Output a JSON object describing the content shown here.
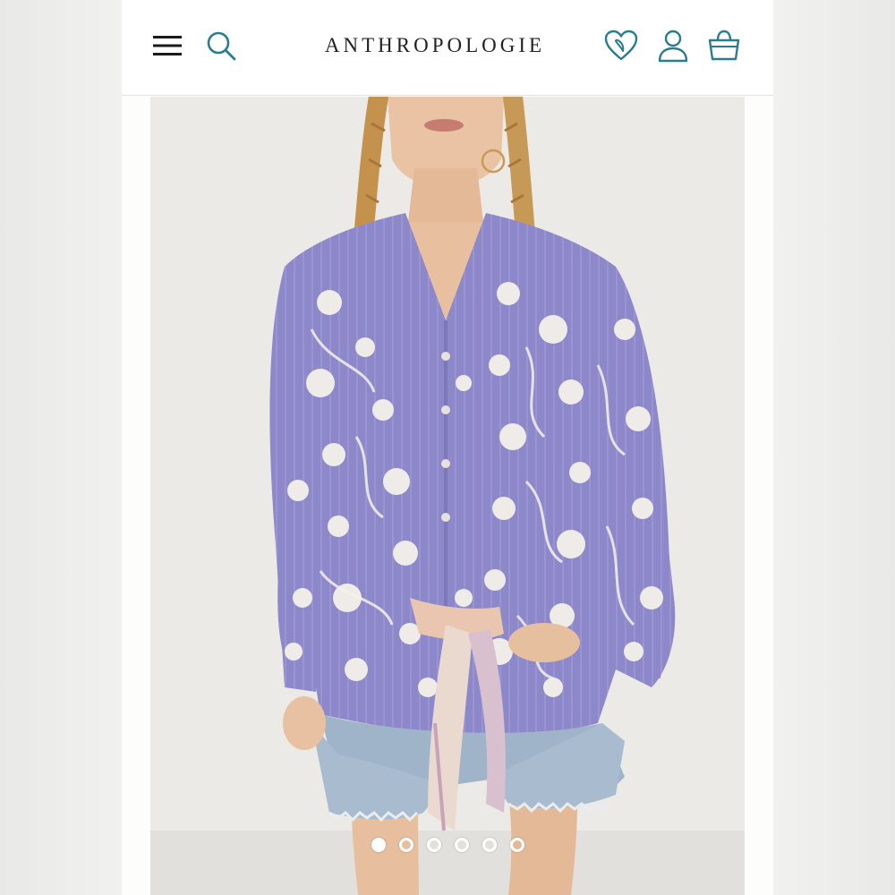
{
  "header": {
    "brand": "ANTHROPOLOGIE",
    "icons": {
      "menu": "hamburger-menu-icon",
      "search": "search-icon",
      "wishlist": "heart-icon",
      "account": "user-icon",
      "bag": "shopping-bag-icon"
    }
  },
  "colors": {
    "accent": "#2a7d8e",
    "header_text": "#222222",
    "shirt": "#8d88c9",
    "embroidery": "#f4f1ea",
    "denim": "#9fb3c9"
  },
  "carousel": {
    "slide_count": 6,
    "active_index": 0
  }
}
